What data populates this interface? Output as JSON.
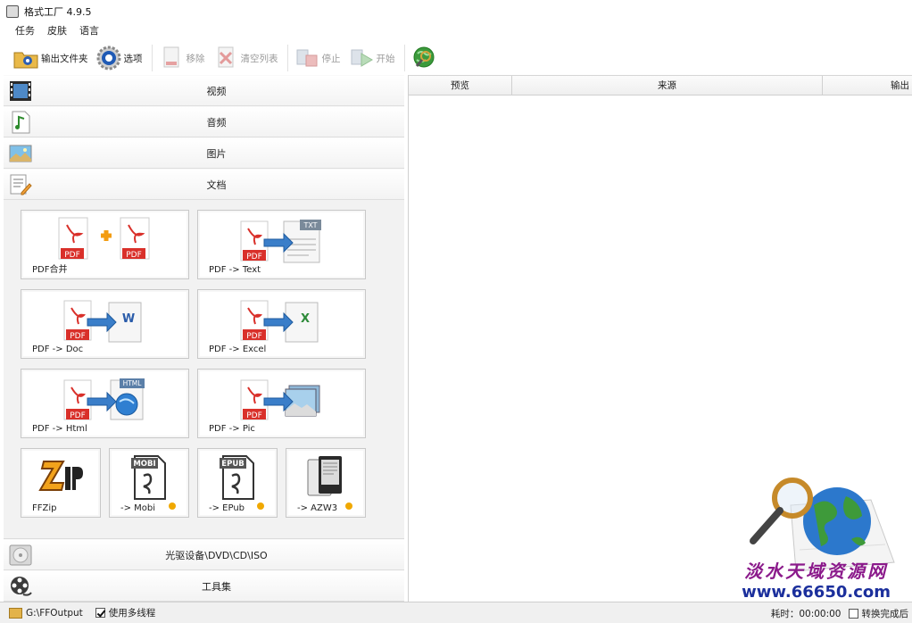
{
  "window": {
    "title": "格式工厂 4.9.5"
  },
  "menu": [
    "任务",
    "皮肤",
    "语言"
  ],
  "toolbar": {
    "output_folder": "输出文件夹",
    "options": "选项",
    "remove": "移除",
    "clear_list": "清空列表",
    "stop": "停止",
    "start": "开始"
  },
  "categories": {
    "video": "视频",
    "audio": "音频",
    "image": "图片",
    "document": "文档",
    "rom": "光驱设备\\DVD\\CD\\ISO",
    "tools": "工具集"
  },
  "doc_tools": {
    "pdf_merge": "PDF合并",
    "pdf_text": "PDF -> Text",
    "pdf_doc": "PDF -> Doc",
    "pdf_excel": "PDF -> Excel",
    "pdf_html": "PDF -> Html",
    "pdf_pic": "PDF -> Pic",
    "ffzip": "FFZip",
    "mobi": "-> Mobi",
    "epub": "-> EPub",
    "azw3": "-> AZW3",
    "badges": {
      "mobi": "MOBI",
      "epub": "EPUB",
      "txt": "TXT",
      "html": "HTML",
      "pdf": "PDF",
      "w": "W",
      "x": "X"
    }
  },
  "table": {
    "columns": [
      "预览",
      "来源",
      "输出"
    ]
  },
  "status": {
    "path": "G:\\FFOutput",
    "multithread": "使用多线程",
    "elapsed": "耗时：00:00:00",
    "after": "转换完成后"
  },
  "watermark": {
    "cn": "淡水天域资源网",
    "url": "www.66650.com"
  },
  "colors": {
    "pdf_red": "#d9302a",
    "arrow_blue": "#3a7ec9",
    "orange_dot": "#f0a800",
    "accent_orange": "#f39c12"
  }
}
